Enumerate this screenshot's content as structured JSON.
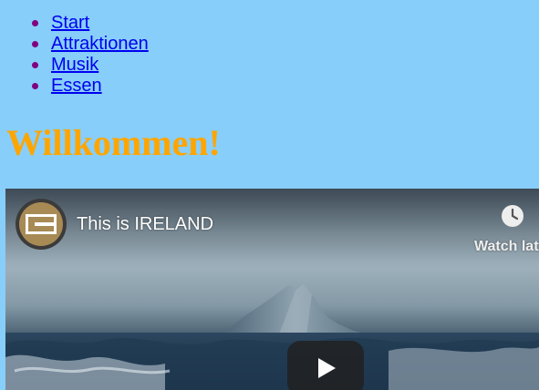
{
  "nav": {
    "items": [
      {
        "label": "Start"
      },
      {
        "label": "Attraktionen"
      },
      {
        "label": "Musik"
      },
      {
        "label": "Essen"
      }
    ]
  },
  "main": {
    "heading": "Willkommen!"
  },
  "video": {
    "title": "This is IRELAND",
    "watch_later_label": "Watch lat",
    "channel_icon": "channel-logo-icon",
    "watch_later_icon": "clock-icon",
    "play_icon": "play-icon"
  },
  "colors": {
    "page_background": "#87cefa",
    "heading": "#ffa500",
    "link": "#0000ee",
    "bullet": "#800080"
  }
}
